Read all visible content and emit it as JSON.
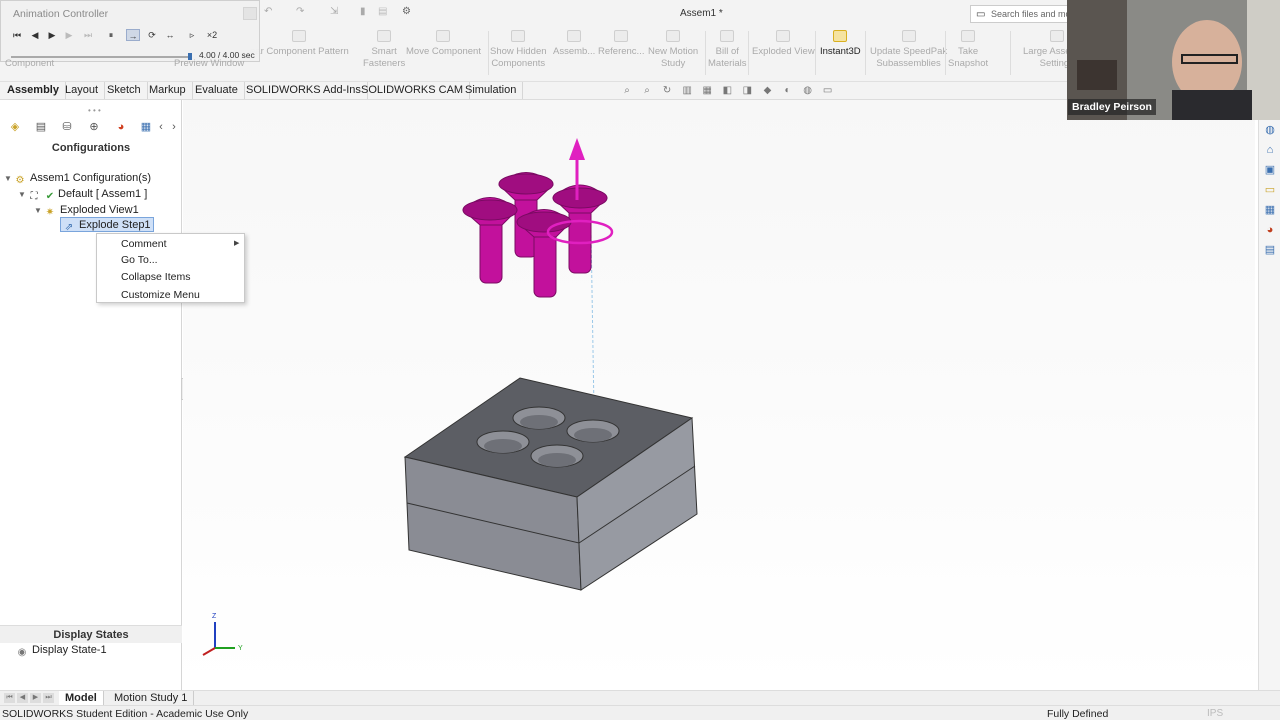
{
  "document": {
    "title": "Assem1 *"
  },
  "search": {
    "placeholder": "Search files and mo"
  },
  "animation_controller": {
    "title": "Animation Controller",
    "time": "4.00 / 4.00 sec",
    "progress": 1.0
  },
  "ribbon": {
    "ghost_left": "Component",
    "ghost_preview": "Preview Window",
    "buttons": [
      {
        "label": "ear Component Pattern",
        "icon": "pattern-icon"
      },
      {
        "label": "Smart\nFasteners",
        "icon": "fastener-icon"
      },
      {
        "label": "Move Component",
        "icon": "move-icon"
      },
      {
        "label": "Show Hidden\nComponents",
        "icon": "show-hidden-icon"
      },
      {
        "label": "Assemb...",
        "icon": "assembly-features-icon"
      },
      {
        "label": "Referenc...",
        "icon": "reference-geometry-icon"
      },
      {
        "label": "New Motion\nStudy",
        "icon": "motion-study-icon"
      },
      {
        "label": "Bill of\nMaterials",
        "icon": "bom-icon"
      },
      {
        "label": "Exploded View",
        "icon": "exploded-view-icon"
      },
      {
        "label": "Instant3D",
        "icon": "instant3d-icon",
        "active": true
      },
      {
        "label": "Update SpeedPak\nSubassemblies",
        "icon": "speedpak-icon"
      },
      {
        "label": "Take\nSnapshot",
        "icon": "snapshot-icon"
      },
      {
        "label": "Large Assembly\nSettings",
        "icon": "large-assembly-icon"
      }
    ]
  },
  "tabs": [
    "Assembly",
    "Layout",
    "Sketch",
    "Markup",
    "Evaluate",
    "SOLIDWORKS Add-Ins",
    "SOLIDWORKS CAM",
    "Simulation"
  ],
  "left_panel": {
    "header": "Configurations",
    "tree": {
      "root": "Assem1 Configuration(s)",
      "default": "Default [ Assem1 ]",
      "exploded": "Exploded View1",
      "step": "Explode Step1"
    },
    "display_states_header": "Display States",
    "display_state": "Display State-1"
  },
  "context_menu": {
    "items": [
      "Comment",
      "Go To...",
      "Collapse Items",
      "Customize Menu"
    ]
  },
  "webcam": {
    "name": "Bradley Peirson"
  },
  "bottom_tabs": [
    "Model",
    "Motion Study 1"
  ],
  "status": {
    "left": "SOLIDWORKS Student Edition - Academic Use Only",
    "right": "Fully Defined",
    "units": "IPS"
  },
  "colors": {
    "screw": "#c2119c",
    "block_top": "#5c5e64",
    "block_side": "#8e9098",
    "selection": "#cfe0f7"
  }
}
